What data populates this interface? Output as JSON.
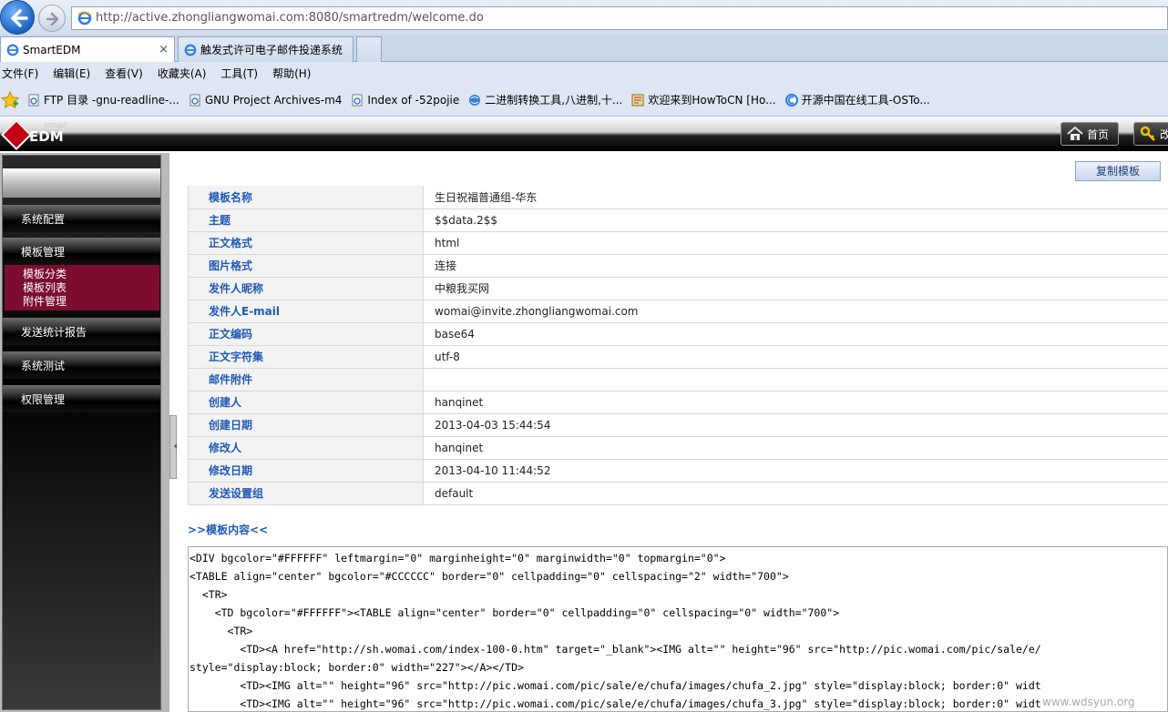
{
  "browser": {
    "url": "http://active.zhongliangwomai.com:8080/smartredm/welcome.do",
    "tabs": [
      {
        "label": "SmartEDM",
        "close": "×"
      },
      {
        "label": "触发式许可电子邮件投递系统"
      }
    ],
    "menu": [
      "文件(F)",
      "编辑(E)",
      "查看(V)",
      "收藏夹(A)",
      "工具(T)",
      "帮助(H)"
    ],
    "favorites": [
      "FTP 目录 -gnu-readline-...",
      "GNU Project Archives-m4",
      "Index of -52pojie",
      "二进制转换工具,八进制,十...",
      "欢迎来到HowToCN [Ho...",
      "开源中国在线工具-OSTo..."
    ]
  },
  "app": {
    "logo_small": "smart",
    "logo_big": "EDM",
    "home_label": "首页",
    "pass_label": "改"
  },
  "sidebar": {
    "items": [
      "系统配置",
      "模板管理",
      "发送统计报告",
      "系统测试",
      "权限管理"
    ],
    "subitems": [
      "模板分类",
      "模板列表",
      "附件管理"
    ]
  },
  "main": {
    "copy_label": "复制模板",
    "rows": [
      {
        "label": "模板名称",
        "value": "生日祝福普通组-华东"
      },
      {
        "label": "主题",
        "value": "$$data.2$$"
      },
      {
        "label": "正文格式",
        "value": "html"
      },
      {
        "label": "图片格式",
        "value": "连接"
      },
      {
        "label": "发件人昵称",
        "value": "中粮我买网"
      },
      {
        "label": "发件人E-mail",
        "value": "womai@invite.zhongliangwomai.com"
      },
      {
        "label": "正文编码",
        "value": "base64"
      },
      {
        "label": "正文字符集",
        "value": "utf-8"
      },
      {
        "label": "邮件附件",
        "value": ""
      },
      {
        "label": "创建人",
        "value": "hanqinet"
      },
      {
        "label": "创建日期",
        "value": "2013-04-03 15:44:54"
      },
      {
        "label": "修改人",
        "value": "hanqinet"
      },
      {
        "label": "修改日期",
        "value": "2013-04-10 11:44:52"
      },
      {
        "label": "发送设置组",
        "value": "default"
      }
    ],
    "section_title": ">>模板内容<<",
    "code": [
      "<DIV bgcolor=\"#FFFFFF\" leftmargin=\"0\" marginheight=\"0\" marginwidth=\"0\" topmargin=\"0\">",
      "<TABLE align=\"center\" bgcolor=\"#CCCCCC\" border=\"0\" cellpadding=\"0\" cellspacing=\"2\" width=\"700\">",
      "  <TR>",
      "    <TD bgcolor=\"#FFFFFF\"><TABLE align=\"center\" border=\"0\" cellpadding=\"0\" cellspacing=\"0\" width=\"700\">",
      "      <TR>",
      "        <TD><A href=\"http://sh.womai.com/index-100-0.htm\" target=\"_blank\"><IMG alt=\"\" height=\"96\" src=\"http://pic.womai.com/pic/sale/e/",
      "style=\"display:block; border:0\" width=\"227\"></A></TD>",
      "        <TD><IMG alt=\"\" height=\"96\" src=\"http://pic.womai.com/pic/sale/e/chufa/images/chufa_2.jpg\" style=\"display:block; border:0\" widt",
      "        <TD><IMG alt=\"\" height=\"96\" src=\"http://pic.womai.com/pic/sale/e/chufa/images/chufa_3.jpg\" style=\"display:block; border:0\" widt"
    ],
    "watermark": "www.wdsyun.org"
  }
}
